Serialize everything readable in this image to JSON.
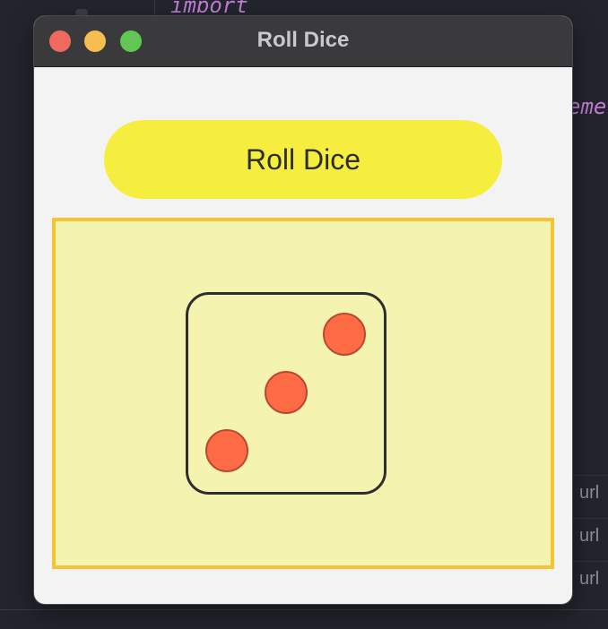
{
  "window": {
    "title": "Roll Dice",
    "controls": {
      "close": "close",
      "minimize": "minimize",
      "maximize": "maximize"
    }
  },
  "main": {
    "roll_button_label": "Roll Dice",
    "die": {
      "face_value": 3,
      "pip_color": "#ff6b45",
      "area_background": "#f5f3b0",
      "area_border_color": "#f6c335"
    }
  },
  "background": {
    "editor_token_top": "import",
    "editor_token_right": "eme",
    "url_rows": [
      "url",
      "url",
      "url"
    ]
  },
  "colors": {
    "button": "#f5ee3f",
    "titlebar": "#3a3a3c",
    "window_body": "#f3f3f3",
    "traffic_close": "#ee6a5f",
    "traffic_min": "#f5be4f",
    "traffic_max": "#62c654"
  }
}
